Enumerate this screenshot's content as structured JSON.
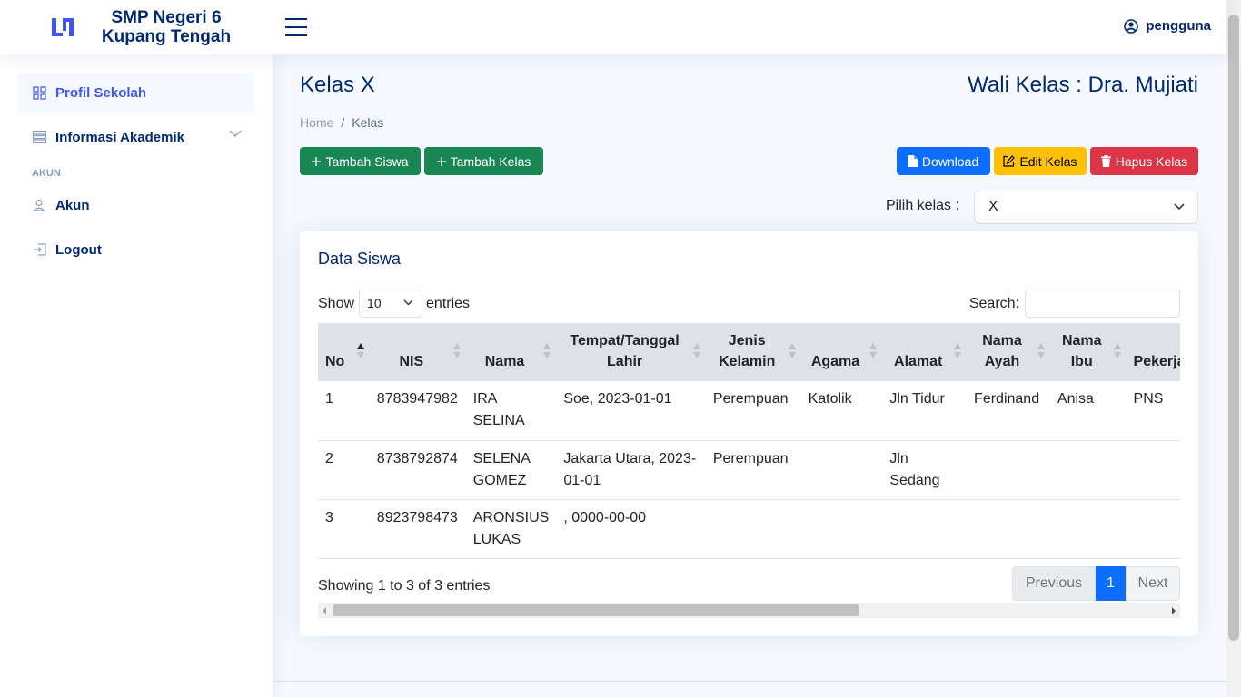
{
  "header": {
    "brand_line1": "SMP Negeri 6",
    "brand_line2": "Kupang Tengah",
    "user_name": "pengguna"
  },
  "sidebar": {
    "items": [
      {
        "label": "Profil Sekolah",
        "icon": "grid-icon",
        "active": true
      },
      {
        "label": "Informasi Akademik",
        "icon": "menu-list-icon"
      },
      {
        "label": "Akun",
        "icon": "person-icon"
      },
      {
        "label": "Logout",
        "icon": "box-arrow-in-right-icon"
      }
    ],
    "heading_akun": "AKUN"
  },
  "main": {
    "title": "Kelas X",
    "wali_kelas": "Wali Kelas : Dra. Mujiati",
    "breadcrumb": [
      "Home",
      "/",
      "Kelas"
    ],
    "buttons": {
      "tambah_siswa": "Tambah Siswa",
      "tambah_kelas": "Tambah Kelas",
      "download": "Download",
      "edit_kelas": "Edit Kelas",
      "hapus_kelas": "Hapus Kelas"
    },
    "pilih_kelas_label": "Pilih kelas :",
    "pilih_kelas_value": "X"
  },
  "card": {
    "title": "Data Siswa",
    "show_label": "Show",
    "entries_label": "entries",
    "length_value": "10",
    "search_label": "Search:",
    "search_value": "",
    "columns": [
      "No",
      "NIS",
      "Nama",
      "Tempat/Tanggal Lahir",
      "Jenis Kelamin",
      "Agama",
      "Alamat",
      "Nama Ayah",
      "Nama Ibu",
      "Pekerjaan Ayah"
    ],
    "rows": [
      [
        "1",
        "8783947982",
        "IRA SELINA",
        "Soe, 2023-01-01",
        "Perempuan",
        "Katolik",
        "Jln Tidur",
        "Ferdinand",
        "Anisa",
        "PNS"
      ],
      [
        "2",
        "8738792874",
        "SELENA GOMEZ",
        "Jakarta Utara, 2023-01-01",
        "Perempuan",
        "",
        "Jln Sedang",
        "",
        "",
        ""
      ],
      [
        "3",
        "8923798473",
        "ARONSIUS LUKAS",
        ", 0000-00-00",
        "",
        "",
        "",
        "",
        "",
        ""
      ]
    ],
    "info": "Showing 1 to 3 of 3 entries",
    "pagination": {
      "previous": "Previous",
      "current": "1",
      "next": "Next"
    }
  },
  "colors": {
    "primary": "#4154f1",
    "navy": "#012970",
    "green": "#198754",
    "blue": "#0d6efd",
    "yellow": "#ffc107",
    "red": "#dc3545"
  }
}
